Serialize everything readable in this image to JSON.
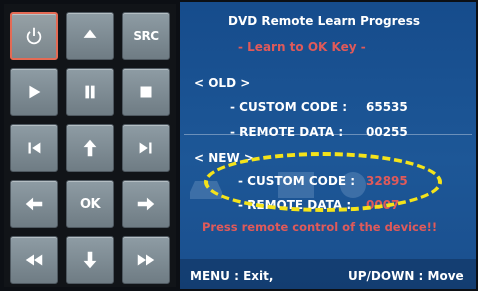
{
  "keypad": {
    "keys": [
      {
        "id": "power",
        "icon": "power-icon",
        "label": ""
      },
      {
        "id": "eject",
        "icon": "eject-icon",
        "label": ""
      },
      {
        "id": "src",
        "icon": "",
        "label": "SRC"
      },
      {
        "id": "play",
        "icon": "play-icon",
        "label": ""
      },
      {
        "id": "pause",
        "icon": "pause-icon",
        "label": ""
      },
      {
        "id": "stop",
        "icon": "stop-icon",
        "label": ""
      },
      {
        "id": "prev",
        "icon": "skip-previous-icon",
        "label": ""
      },
      {
        "id": "up",
        "icon": "arrow-up-icon",
        "label": ""
      },
      {
        "id": "next",
        "icon": "skip-next-icon",
        "label": ""
      },
      {
        "id": "left",
        "icon": "arrow-left-icon",
        "label": ""
      },
      {
        "id": "ok",
        "icon": "",
        "label": "OK"
      },
      {
        "id": "right",
        "icon": "arrow-right-icon",
        "label": ""
      },
      {
        "id": "rewind",
        "icon": "rewind-icon",
        "label": ""
      },
      {
        "id": "down",
        "icon": "arrow-down-icon",
        "label": ""
      },
      {
        "id": "fastforward",
        "icon": "fast-forward-icon",
        "label": ""
      }
    ]
  },
  "panel": {
    "title": "DVD Remote Learn Progress",
    "subtitle": "- Learn to OK Key -",
    "old": {
      "heading": "< OLD >",
      "custom_code_label": "- CUSTOM CODE :",
      "custom_code_value": "65535",
      "remote_data_label": "- REMOTE DATA :",
      "remote_data_value": "00255"
    },
    "new": {
      "heading": "< NEW >",
      "custom_code_label": "- CUSTOM CODE :",
      "custom_code_value": "32895",
      "remote_data_label": "- REMOTE DATA :",
      "remote_data_value": "0007"
    },
    "prompt": "Press remote control of the device!!",
    "footer": {
      "menu": "MENU : Exit,",
      "updown": "UP/DOWN : Move"
    }
  },
  "colors": {
    "panel_blue": "#1d5797",
    "highlight_red": "#e05a5a",
    "annotation_yellow": "#f4e31a",
    "key_gray": "#7f8c94"
  }
}
